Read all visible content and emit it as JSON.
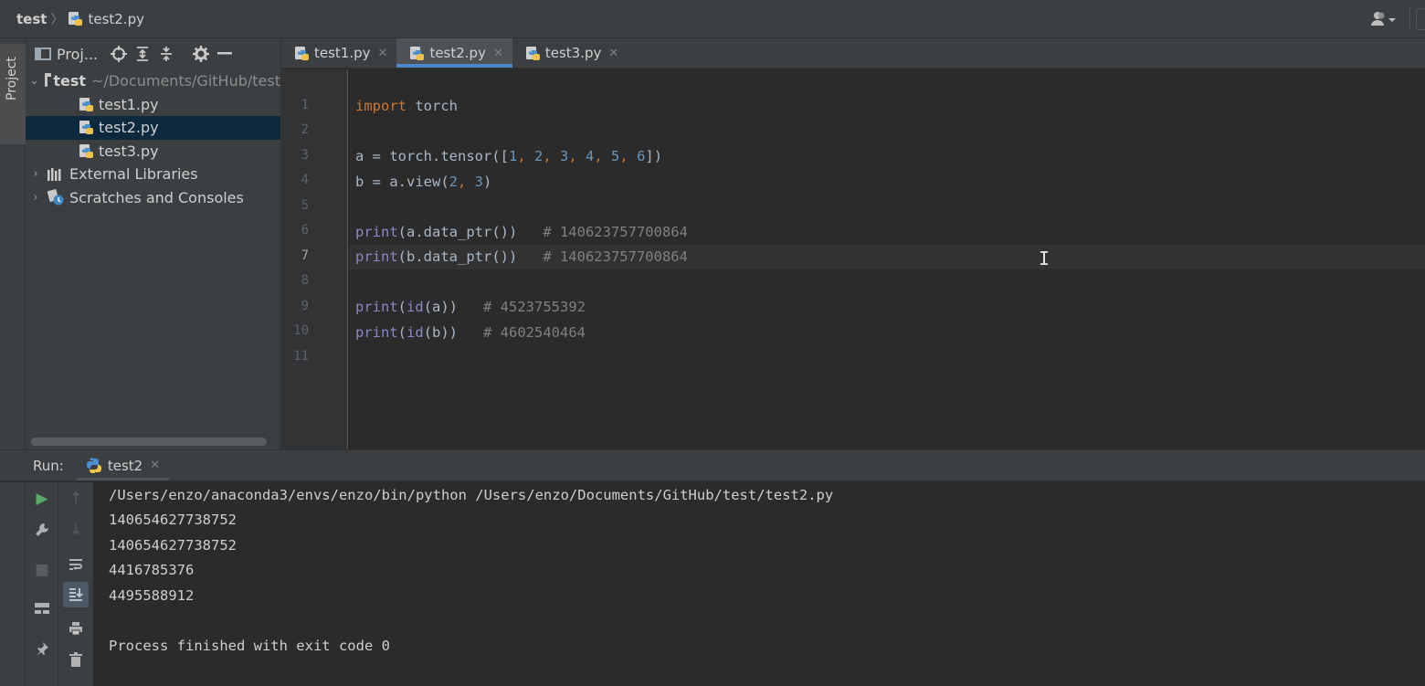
{
  "navbar": {
    "project": "test",
    "separator": "〉",
    "file": "test2.py"
  },
  "tool_strip": {
    "project_label": "Project"
  },
  "project_panel": {
    "title": "Proj...",
    "tree": {
      "root_name": "test",
      "root_path": "~/Documents/GitHub/test",
      "files": [
        "test1.py",
        "test2.py",
        "test3.py"
      ],
      "selected_file": "test2.py",
      "external_libraries": "External Libraries",
      "scratches": "Scratches and Consoles"
    }
  },
  "editor": {
    "tabs": [
      {
        "label": "test1.py",
        "active": false
      },
      {
        "label": "test2.py",
        "active": true
      },
      {
        "label": "test3.py",
        "active": false
      }
    ],
    "current_line": 7,
    "line_numbers": [
      "1",
      "2",
      "3",
      "4",
      "5",
      "6",
      "7",
      "8",
      "9",
      "10",
      "11"
    ],
    "code": {
      "l1": {
        "kw": "import",
        "rest": " torch"
      },
      "l3": {
        "pre": "a = torch.tensor([",
        "n1": "1",
        "c1": ", ",
        "n2": "2",
        "c2": ", ",
        "n3": "3",
        "c3": ", ",
        "n4": "4",
        "c4": ", ",
        "n5": "5",
        "c5": ", ",
        "n6": "6",
        "post": "])"
      },
      "l4": {
        "pre": "b = a.view(",
        "n1": "2",
        "c1": ", ",
        "n2": "3",
        "post": ")"
      },
      "l6": {
        "fn": "print",
        "rest": "(a.data_ptr())   ",
        "comment": "# 140623757700864"
      },
      "l7": {
        "fn": "print",
        "rest": "(b.data_ptr())   ",
        "comment": "# 140623757700864"
      },
      "l9": {
        "fn": "print",
        "p1": "(",
        "fn2": "id",
        "rest": "(a))   ",
        "comment": "# 4523755392"
      },
      "l10": {
        "fn": "print",
        "p1": "(",
        "fn2": "id",
        "rest": "(b))   ",
        "comment": "# 4602540464"
      }
    }
  },
  "run": {
    "label": "Run:",
    "tab": "test2",
    "output": [
      "/Users/enzo/anaconda3/envs/enzo/bin/python /Users/enzo/Documents/GitHub/test/test2.py",
      "140654627738752",
      "140654627738752",
      "4416785376",
      "4495588912",
      "",
      "Process finished with exit code 0"
    ]
  },
  "colors": {
    "keyword": "#cc7832",
    "number": "#6897bb",
    "builtin": "#8888c6",
    "comment": "#808080",
    "accent": "#4a88c7"
  }
}
